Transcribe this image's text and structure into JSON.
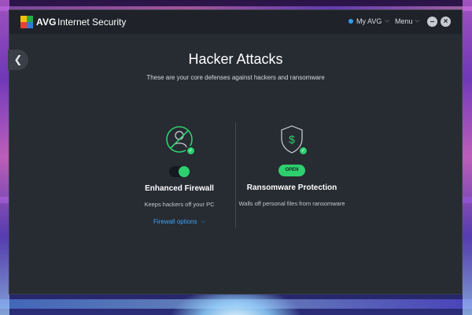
{
  "app": {
    "brand": "AVG",
    "product": "Internet Security",
    "my_avg_label": "My AVG",
    "menu_label": "Menu"
  },
  "page": {
    "title": "Hacker Attacks",
    "subtitle": "These are your core defenses against hackers and ransomware"
  },
  "firewall": {
    "title": "Enhanced Firewall",
    "description": "Keeps hackers off your PC",
    "link_label": "Firewall options",
    "toggle_on": true
  },
  "ransomware": {
    "title": "Ransomware Protection",
    "description": "Walls off personal files from ransomware",
    "button_label": "OPEN"
  },
  "colors": {
    "accent_green": "#2ecf6f",
    "link_blue": "#3ba3f5",
    "window_bg": "#272b32"
  }
}
